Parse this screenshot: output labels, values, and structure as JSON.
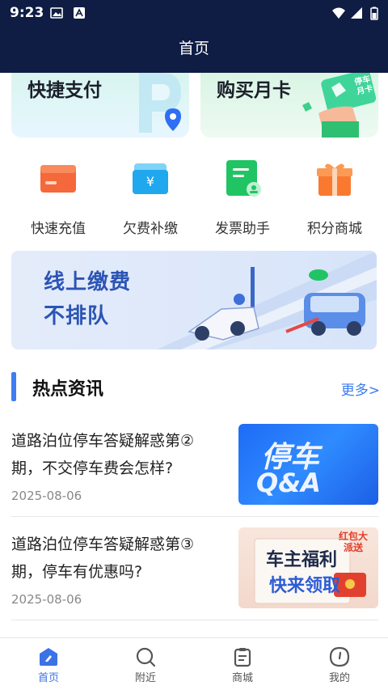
{
  "status_bar": {
    "time": "9:23"
  },
  "header": {
    "title": "首页"
  },
  "quick_cards": [
    {
      "title": "快捷支付",
      "icon": "parking-p-icon"
    },
    {
      "title": "购买月卡",
      "icon": "monthly-card-icon",
      "card_text": "停车月卡"
    }
  ],
  "menu": [
    {
      "label": "快速充值",
      "icon": "wallet-icon",
      "color": "#f5683b"
    },
    {
      "label": "欠费补缴",
      "icon": "yen-card-icon",
      "color": "#1fa8ee"
    },
    {
      "label": "发票助手",
      "icon": "invoice-icon",
      "color": "#21c463"
    },
    {
      "label": "积分商城",
      "icon": "gift-icon",
      "color": "#f97a2f"
    }
  ],
  "banner": {
    "line1": "线上缴费",
    "line2": "不排队"
  },
  "news_section": {
    "title": "热点资讯",
    "more_label": "更多>"
  },
  "news": [
    {
      "title": "道路泊位停车答疑解惑第②期，不交停车费会怎样?",
      "date": "2025-08-06",
      "thumb_line1": "停车",
      "thumb_line2": "Q&A"
    },
    {
      "title": "道路泊位停车答疑解惑第③期，停车有优惠吗?",
      "date": "2025-08-06",
      "thumb_line1": "车主福利",
      "thumb_line2": "快来领取",
      "thumb_badge": "红包大派送"
    }
  ],
  "tabs": [
    {
      "label": "首页",
      "icon": "home-icon",
      "active": true
    },
    {
      "label": "附近",
      "icon": "search-icon",
      "active": false
    },
    {
      "label": "商城",
      "icon": "clipboard-icon",
      "active": false
    },
    {
      "label": "我的",
      "icon": "profile-icon",
      "active": false
    }
  ],
  "colors": {
    "header_bg": "#0f1c43",
    "accent": "#3b72e6"
  }
}
